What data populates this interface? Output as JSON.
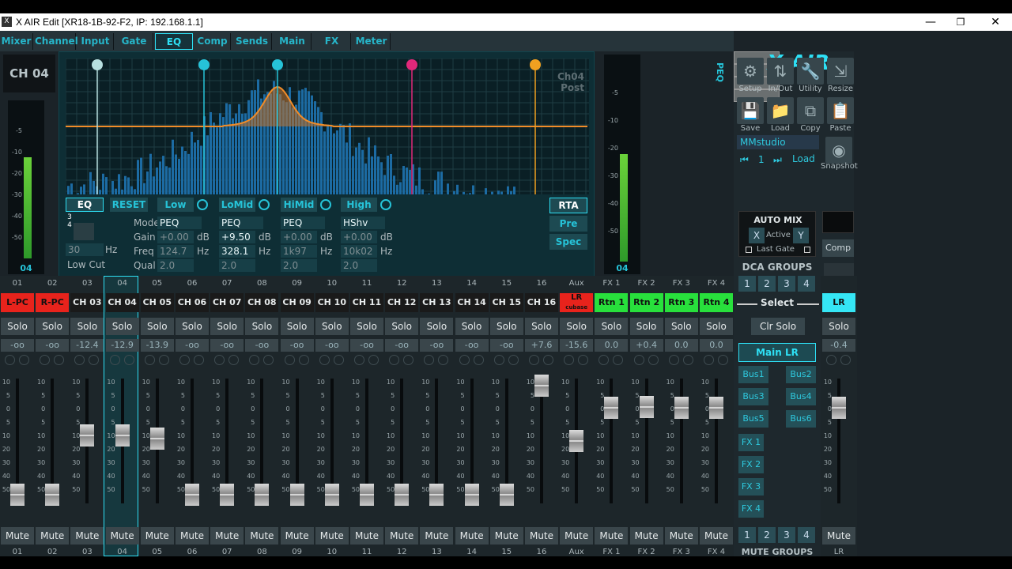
{
  "window": {
    "title": "X AIR Edit [XR18-1B-92-F2, IP: 192.168.1.1]"
  },
  "tabs": [
    "Mixer",
    "Channel",
    "Input",
    "Gate",
    "EQ",
    "Comp",
    "Sends",
    "Main",
    "FX",
    "Meter"
  ],
  "active_tab": "EQ",
  "channel_label": "CH 04",
  "eq": {
    "graph_label": [
      "Ch04",
      "Post"
    ],
    "peq_label": "PEQ",
    "eq_button": "EQ",
    "reset_button": "RESET",
    "bands": [
      {
        "name": "Low",
        "mode": "PEQ",
        "gain": "+0.00",
        "freq": "124.7",
        "qual": "2.0"
      },
      {
        "name": "LoMid",
        "mode": "PEQ",
        "gain": "+9.50",
        "freq": "328.1",
        "qual": "2.0"
      },
      {
        "name": "HiMid",
        "mode": "PEQ",
        "gain": "+0.00",
        "freq": "1k97",
        "qual": "2.0"
      },
      {
        "name": "High",
        "mode": "HShv",
        "gain": "+0.00",
        "freq": "10k02",
        "qual": "2.0"
      }
    ],
    "row_labels": {
      "mode": "Mode",
      "gain": "Gain",
      "freq": "Freq",
      "qual": "Qual"
    },
    "units": {
      "db": "dB",
      "hz": "Hz"
    },
    "lowcut": {
      "value": "30",
      "unit": "Hz",
      "label": "Low Cut"
    },
    "band_markers": [
      "1",
      "2",
      "3",
      "4"
    ],
    "rta_buttons": [
      "RTA",
      "Pre",
      "Spec"
    ]
  },
  "left_meter": {
    "scale": [
      "-5",
      "-10",
      "-20",
      "-30",
      "-40",
      "-50"
    ],
    "label": "04"
  },
  "right_meter": {
    "scale": [
      "-5",
      "-10",
      "-20",
      "-30",
      "-40",
      "-50"
    ],
    "label": "04"
  },
  "sidebar": {
    "logo": "X AIR",
    "tools": [
      "Setup",
      "In/Out",
      "Utility",
      "Resize",
      "Save",
      "Load",
      "Copy",
      "Paste"
    ],
    "preset_name": "MMstudio",
    "snapshot_number": "1",
    "snapshot_load": "Load",
    "snapshot_label": "Snapshot",
    "automix": {
      "title": "AUTO MIX",
      "x": "X",
      "active": "Active",
      "y": "Y",
      "last_gate": "Last Gate"
    },
    "comp_label": "Comp",
    "lr_label": "LR",
    "dca_title": "DCA GROUPS",
    "dca": [
      "1",
      "2",
      "3",
      "4"
    ],
    "select_label": "Select",
    "clr_solo": "Clr Solo",
    "main_lr": "Main LR",
    "buses": [
      "Bus1",
      "Bus2",
      "Bus3",
      "Bus4",
      "Bus5",
      "Bus6"
    ],
    "fx": [
      "FX 1",
      "FX 2",
      "FX 3",
      "FX 4"
    ],
    "mute_groups": [
      "1",
      "2",
      "3",
      "4"
    ],
    "mute_title": "MUTE GROUPS"
  },
  "channels": [
    {
      "num": "01",
      "name": "L-PC",
      "color": "#e8231c",
      "gain": "-oo",
      "fader": 0.05
    },
    {
      "num": "02",
      "name": "R-PC",
      "color": "#e8231c",
      "gain": "-oo",
      "fader": 0.05
    },
    {
      "num": "03",
      "name": "CH 03",
      "color": "#1a1a1a",
      "gain": "-12.4",
      "fader": 0.55
    },
    {
      "num": "04",
      "name": "CH 04",
      "color": "#1a1a1a",
      "gain": "-12.9",
      "fader": 0.55
    },
    {
      "num": "05",
      "name": "CH 05",
      "color": "#1a1a1a",
      "gain": "-13.9",
      "fader": 0.52
    },
    {
      "num": "06",
      "name": "CH 06",
      "color": "#1a1a1a",
      "gain": "-oo",
      "fader": 0.05
    },
    {
      "num": "07",
      "name": "CH 07",
      "color": "#1a1a1a",
      "gain": "-oo",
      "fader": 0.05
    },
    {
      "num": "08",
      "name": "CH 08",
      "color": "#1a1a1a",
      "gain": "-oo",
      "fader": 0.05
    },
    {
      "num": "09",
      "name": "CH 09",
      "color": "#1a1a1a",
      "gain": "-oo",
      "fader": 0.05
    },
    {
      "num": "10",
      "name": "CH 10",
      "color": "#1a1a1a",
      "gain": "-oo",
      "fader": 0.05
    },
    {
      "num": "11",
      "name": "CH 11",
      "color": "#1a1a1a",
      "gain": "-oo",
      "fader": 0.05
    },
    {
      "num": "12",
      "name": "CH 12",
      "color": "#1a1a1a",
      "gain": "-oo",
      "fader": 0.05
    },
    {
      "num": "13",
      "name": "CH 13",
      "color": "#1a1a1a",
      "gain": "-oo",
      "fader": 0.05
    },
    {
      "num": "14",
      "name": "CH 14",
      "color": "#1a1a1a",
      "gain": "-oo",
      "fader": 0.05
    },
    {
      "num": "15",
      "name": "CH 15",
      "color": "#1a1a1a",
      "gain": "-oo",
      "fader": 0.05
    },
    {
      "num": "16",
      "name": "CH 16",
      "color": "#1a1a1a",
      "gain": "+7.6",
      "fader": 0.97
    },
    {
      "num": "Aux",
      "name": "LR",
      "sub": "cubase",
      "color": "#e8231c",
      "gain": "-15.6",
      "fader": 0.5
    },
    {
      "num": "FX 1",
      "bottom": "FX 1",
      "name": "Rtn 1",
      "color": "#28e03c",
      "gain": "0.0",
      "fader": 0.78
    },
    {
      "num": "FX 2",
      "bottom": "FX 2",
      "name": "Rtn 2",
      "color": "#28e03c",
      "gain": "+0.4",
      "fader": 0.79
    },
    {
      "num": "FX 3",
      "bottom": "FX 3",
      "name": "Rtn 3",
      "color": "#28e03c",
      "gain": "0.0",
      "fader": 0.78
    },
    {
      "num": "FX 4",
      "bottom": "FX 4",
      "name": "Rtn 4",
      "color": "#28e03c",
      "gain": "0.0",
      "fader": 0.78
    }
  ],
  "lr_strip": {
    "name": "LR",
    "color": "#35e6f5",
    "gain": "-0.4",
    "fader": 0.78,
    "solo": "Solo",
    "mute": "Mute",
    "bottom": "LR"
  },
  "strip_labels": {
    "solo": "Solo",
    "mute": "Mute"
  },
  "fader_scale": [
    "10",
    "5",
    "0",
    "5",
    "10",
    "20",
    "30",
    "40",
    "50"
  ]
}
